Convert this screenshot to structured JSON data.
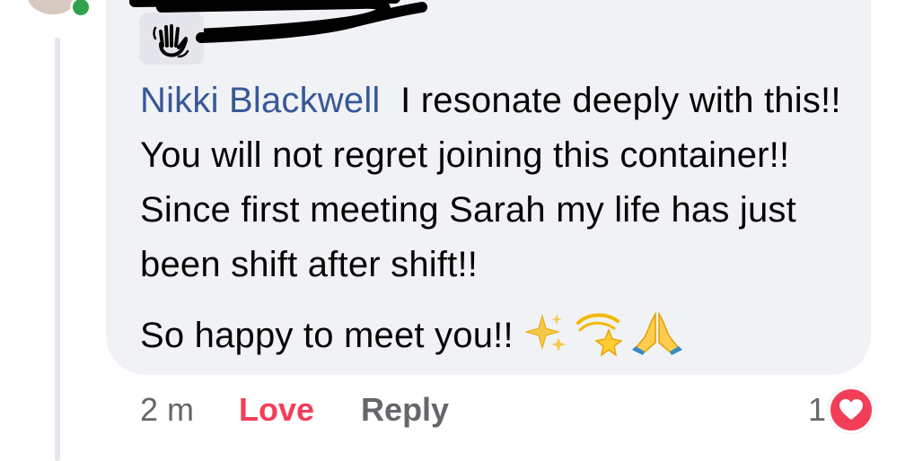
{
  "comment": {
    "mention": "Nikki Blackwell",
    "body_first": "I resonate deeply with this!! You will not regret joining this container!! Since first meeting Sarah my life has just been shift after shift!!",
    "body_second": "So happy to meet you!!",
    "emojis": [
      "sparkles-icon",
      "dizzy-star-icon",
      "folded-hands-icon"
    ]
  },
  "actions": {
    "time": "2 m",
    "love_label": "Love",
    "reply_label": "Reply"
  },
  "reactions": {
    "count": "1",
    "type": "heart-icon"
  },
  "colors": {
    "bubble": "#f0f2f5",
    "mention": "#385898",
    "love": "#f33e58",
    "secondary_text": "#65676b",
    "online": "#31a24c"
  }
}
